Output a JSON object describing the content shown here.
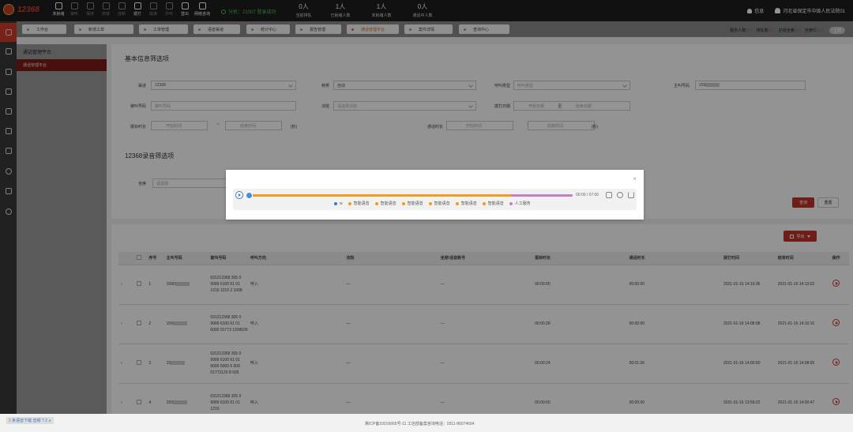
{
  "app": {
    "logo_text": "12368"
  },
  "toolbar": [
    {
      "label": "未就绪",
      "on": true
    },
    {
      "label": "接听",
      "on": false
    },
    {
      "label": "保持",
      "on": false
    },
    {
      "label": "转接",
      "on": false
    },
    {
      "label": "挂断",
      "on": false
    },
    {
      "label": "拨打",
      "on": true
    },
    {
      "label": "挑接",
      "on": false
    },
    {
      "label": "外呼",
      "on": false
    },
    {
      "label": "登出",
      "on": true
    },
    {
      "label": "网络咨询",
      "on": true
    }
  ],
  "status": {
    "text": "分机：21007 登录成功"
  },
  "stats": [
    {
      "value": "0人",
      "label": "当前排队"
    },
    {
      "value": "1人",
      "label": "已就绪人数"
    },
    {
      "value": "1人",
      "label": "未就绪人数"
    },
    {
      "value": "0人",
      "label": "通话中人数"
    }
  ],
  "top_right": {
    "notice": "信息",
    "org": "河北省保定市中级人民法院01"
  },
  "nav_tabs": [
    "工作台",
    "新增工单",
    "工单管理",
    "语音渠道",
    "统计中心",
    "报告管理",
    "通话管理平台",
    "案件详情",
    "查询中心"
  ],
  "nav_active_index": 6,
  "service_stats": {
    "service_label": "服务人数:",
    "service_value": "0人",
    "queue_label": "排队数:",
    "queue_value": "0人",
    "online_label": "在线坐席:",
    "online_value": "1人",
    "busy_label": "坐席忙:",
    "busy_value": "0人",
    "online_btn": "上线"
  },
  "submenu": {
    "title": "通话管理平台",
    "active": "通话管理平台"
  },
  "filters": {
    "section_title": "基本信息筛选项",
    "channel_label": "渠道",
    "channel_value": "12368",
    "type_label": "种类",
    "type_value": "自动",
    "call_type_label": "呼叫类型",
    "call_type_placeholder": "呼叫类型",
    "caller_label": "主叫号码",
    "caller_value": "159",
    "callee_label": "被叫号码",
    "callee_placeholder": "被叫号码",
    "court_label": "法院",
    "court_placeholder": "请选择法院",
    "date_label": "拨打日期",
    "date_start": "开始日期",
    "date_sep": "至",
    "date_end": "结束日期",
    "ring_label": "振铃时长",
    "ring_start": "开始时间",
    "ring_end": "结束时间",
    "dash": "~",
    "talk_label": "通话时长",
    "talk_start": "开始时间",
    "talk_end": "结束时间",
    "unit": "(秒)",
    "section2_title": "12368录音筛选项",
    "seat_label": "坐席",
    "seat_placeholder": "请选择",
    "search_btn": "查询",
    "reset_btn": "重置"
  },
  "export_btn": "导出",
  "table": {
    "headers": [
      "",
      "",
      "序号",
      "主叫号码",
      "被叫号码",
      "呼叫方向",
      "法院",
      "坐席/话音账号",
      "振铃时长",
      "通话时长",
      "拨打时间",
      "结束时间",
      "操作"
    ],
    "rows": [
      {
        "no": "1",
        "caller": "1590",
        "callee": "031212368 305 0 9999 6100 61 01 1210 1210 2 1008",
        "direction": "呼入",
        "court": "—",
        "seat": "—",
        "ring": "00:00:00",
        "talk": "00:00:00",
        "start": "2021-01-16 14:10:36",
        "end": "2021-01-16 14:13:02"
      },
      {
        "no": "2",
        "caller": "159",
        "callee": "031212368 305 0 9999 6100 61 01 6000 01773 1208026",
        "direction": "呼入",
        "court": "—",
        "seat": "—",
        "ring": "00:00:28",
        "talk": "00:00:00",
        "start": "2021-01-16 14:08:08",
        "end": "2021-01-16 14:10:10"
      },
      {
        "no": "3",
        "caller": "15",
        "callee": "031212368 305 0 9999 6100 61 01 6000 6000 6 000 01773120 8 026",
        "direction": "呼入",
        "court": "—",
        "seat": "—",
        "ring": "00:00:24",
        "talk": "00:01:06",
        "start": "2021-01-16 14:00:50",
        "end": "2021-01-16 14:08:05"
      },
      {
        "no": "4",
        "caller": "159",
        "callee": "031212368 305 0 9999 6100 61 01 1210",
        "direction": "呼入",
        "court": "—",
        "seat": "—",
        "ring": "00:00:00",
        "talk": "00:00:00",
        "start": "2021-01-16 13:59:22",
        "end": "2021-01-16 14:00:47"
      }
    ]
  },
  "footer": {
    "icp": "冀ICP备10016665号-11 工信部备案咨询电话：0311-86074694",
    "download": "1 条语音下载 音频 ? 2 ∧"
  },
  "player": {
    "time": "00:00 / 07:00",
    "progress_fraction": 0.0,
    "ai_fraction": 0.81,
    "legend": [
      {
        "label": "w",
        "color": "#3a78c4"
      },
      {
        "label": "智能语音",
        "color": "#f29b1c"
      },
      {
        "label": "智能语音",
        "color": "#f29b1c"
      },
      {
        "label": "智能语音",
        "color": "#f29b1c"
      },
      {
        "label": "智能语音",
        "color": "#f29b1c"
      },
      {
        "label": "智能语音",
        "color": "#f29b1c"
      },
      {
        "label": "智能语音",
        "color": "#f29b1c"
      },
      {
        "label": "人工服务",
        "color": "#c87fc0"
      }
    ]
  },
  "colors": {
    "brand_red": "#c0322a",
    "accent_orange": "#e0692a",
    "topbar": "#1e1e1e"
  }
}
